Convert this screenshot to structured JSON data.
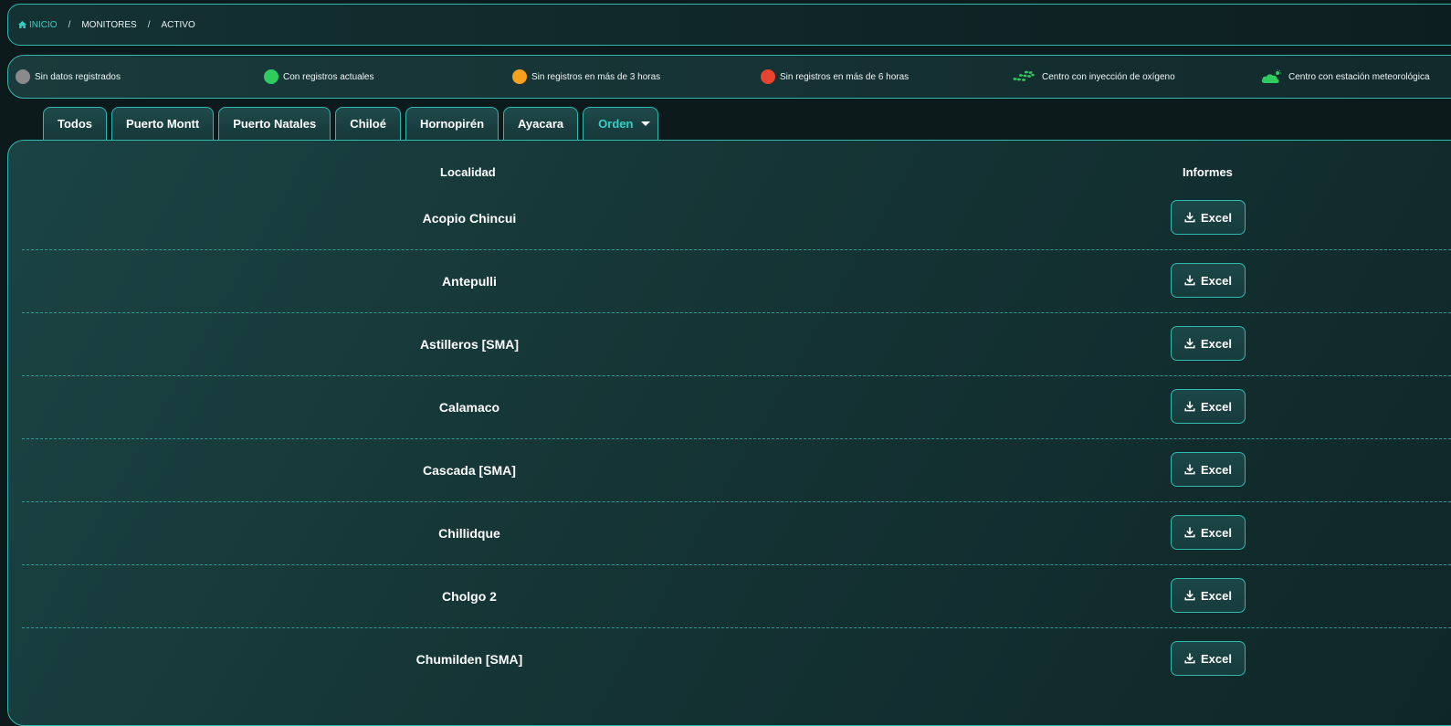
{
  "breadcrumb": {
    "home_label": "INICIO",
    "items": [
      "MONITORES",
      "ACTIVO"
    ],
    "home_color": "#2fd1c7"
  },
  "legend": {
    "items": [
      {
        "label": "Sin datos registrados",
        "color": "#8a8a8a",
        "icon": "gray-status-dot"
      },
      {
        "label": "Con registros actuales",
        "color": "#2ecc5e",
        "icon": "green-status-dot"
      },
      {
        "label": "Sin registros en más de 3 horas",
        "color": "#f5a11c",
        "icon": "orange-status-dot"
      },
      {
        "label": "Sin registros en más de 6 horas",
        "color": "#e8432e",
        "icon": "red-status-dot"
      },
      {
        "label": "Centro con inyección de oxígeno",
        "color": "#2ecc5e",
        "icon": "oxygen-bubbles-icon"
      },
      {
        "label": "Centro con estación meteorológica",
        "color": "#2ecc5e",
        "icon": "weather-cloud-icon"
      }
    ]
  },
  "tabs": {
    "items": [
      "Todos",
      "Puerto Montt",
      "Puerto Natales",
      "Chiloé",
      "Hornopirén",
      "Ayacara"
    ],
    "orden_label": "Orden"
  },
  "table": {
    "headers": {
      "location": "Localidad",
      "reports": "Informes"
    },
    "button_label": "Excel",
    "rows": [
      "Acopio Chincui",
      "Antepulli",
      "Astilleros [SMA]",
      "Calamaco",
      "Cascada [SMA]",
      "Chillidque",
      "Cholgo 2",
      "Chumilden [SMA]"
    ]
  },
  "colors": {
    "accent": "#2fb8b0",
    "background": "#0c1a1c"
  }
}
